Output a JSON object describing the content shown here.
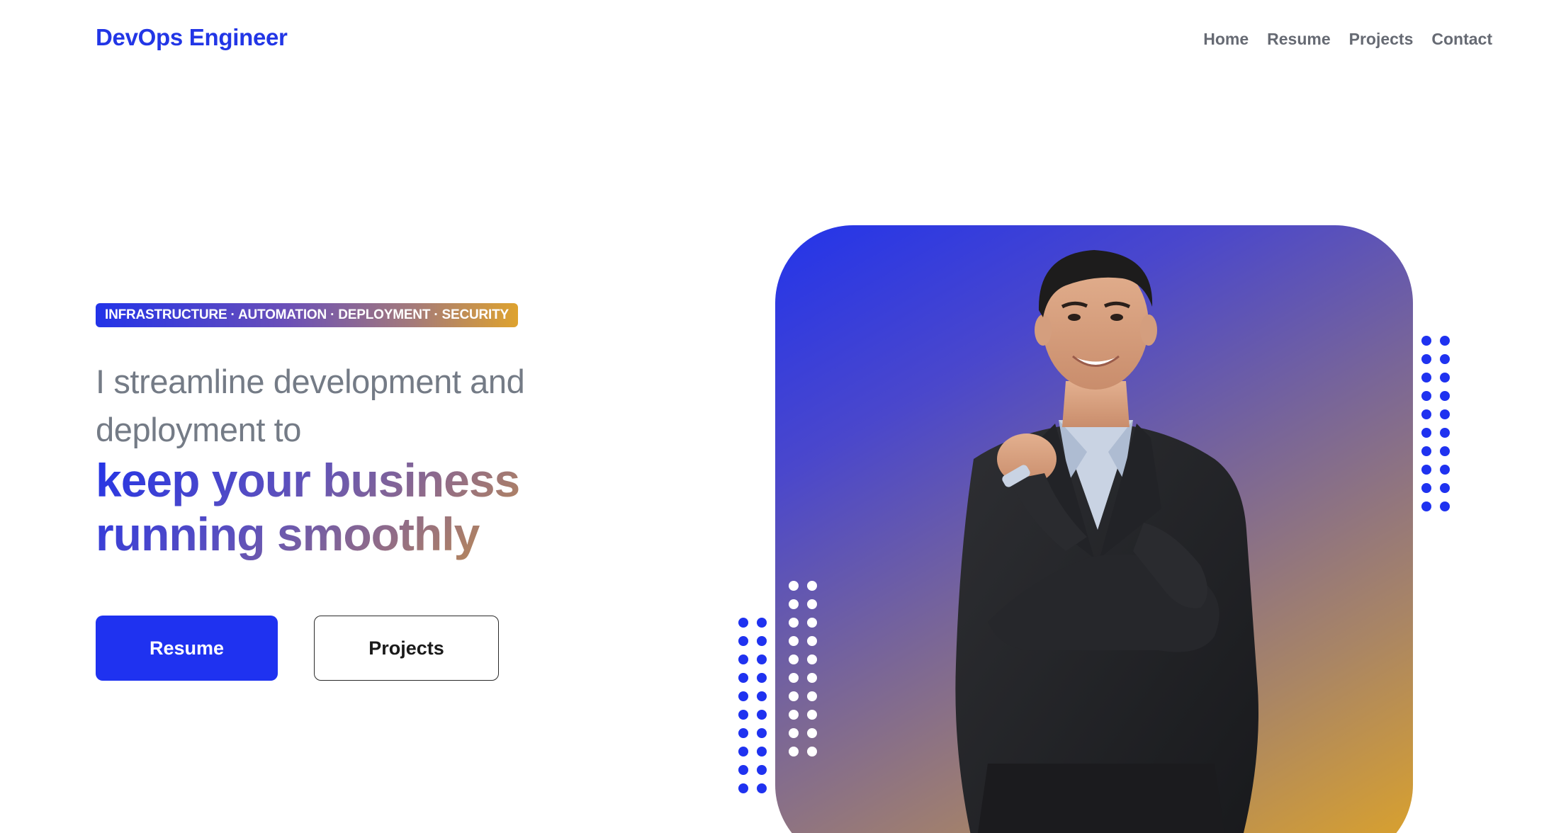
{
  "header": {
    "brand": "DevOps Engineer",
    "nav": [
      "Home",
      "Resume",
      "Projects",
      "Contact"
    ]
  },
  "hero": {
    "tagline": "INFRASTRUCTURE · AUTOMATION · DEPLOYMENT · SECURITY",
    "lead": "I streamline development and deployment to",
    "headline": "keep your business running smoothly",
    "buttons": {
      "primary": "Resume",
      "secondary": "Projects"
    }
  },
  "colors": {
    "brand_blue": "#1f32f0",
    "accent_gold": "#dea22e",
    "nav_gray": "#666a73",
    "lead_gray": "#747b86"
  },
  "decor": {
    "portrait": "person-in-suit-photo",
    "dot_grids": [
      "white-dots-top-right",
      "blue-dots-right",
      "white-dots-bottom-left",
      "blue-dots-left"
    ]
  }
}
